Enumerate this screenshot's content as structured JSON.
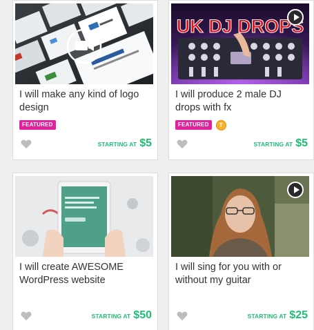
{
  "colors": {
    "featured": "#e0239c",
    "price": "#1dbf73",
    "heart": "#bdbdbd",
    "level_badge": "#f6b12e"
  },
  "gigs": [
    {
      "title": "I will make any kind of logo design",
      "featured_label": "FEATURED",
      "starting_label": "STARTING AT",
      "price": "$5",
      "thumb_icon": "video-camera-icon"
    },
    {
      "title": "I will produce 2 male DJ drops with fx",
      "featured_label": "FEATURED",
      "level_badge": "T",
      "starting_label": "STARTING AT",
      "price": "$5",
      "thumb_text": "UK DJ DROPS",
      "thumb_icon": "play-icon"
    },
    {
      "title": "I will create AWESOME WordPress website",
      "starting_label": "STARTING AT",
      "price": "$50"
    },
    {
      "title": "I will sing for you with or without my guitar",
      "starting_label": "STARTING AT",
      "price": "$25",
      "thumb_icon": "play-icon"
    }
  ]
}
